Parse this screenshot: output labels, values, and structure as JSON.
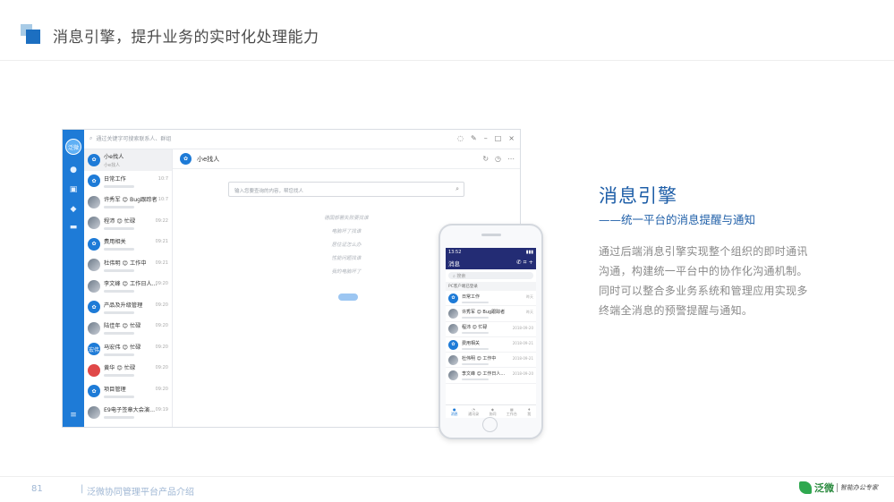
{
  "header": {
    "title": "消息引擎，提升业务的实时化处理能力"
  },
  "desktop": {
    "rail_avatar": "泛微",
    "search_placeholder": "通过关键字可搜索联系人、群组",
    "chats": [
      {
        "name": "小e找人",
        "sub": "小e找人",
        "time": ""
      },
      {
        "name": "日常工作",
        "time": "10:7"
      },
      {
        "name": "许秀军 😊 Bug跟踪者",
        "time": "10:7"
      },
      {
        "name": "程沛 😊 忙碌",
        "time": "09:22"
      },
      {
        "name": "费用相关",
        "time": "09:21"
      },
      {
        "name": "杜伟明 😊 工作中",
        "time": "09:21"
      },
      {
        "name": "李文峰 😊 工作日人...",
        "time": "09:20"
      },
      {
        "name": "产品及升级管理",
        "time": "09:20"
      },
      {
        "name": "陆佳年 😊 忙碌",
        "time": "09:20"
      },
      {
        "name": "马宏伟 😊 忙碌",
        "time": "09:20"
      },
      {
        "name": "黄华 😊 忙碌",
        "time": "09:20"
      },
      {
        "name": "项目管理",
        "time": "09:20"
      },
      {
        "name": "E9电子签章大会演...",
        "time": "09:19"
      }
    ],
    "chat_title": "小e找人",
    "chat_search_placeholder": "输入您要查询的内容，帮您找人",
    "suggestions": [
      "德国部署失败要找谁",
      "电脑坏了找谁",
      "居住证怎么办",
      "性能问题找谁",
      "我的电脑坏了"
    ]
  },
  "mobile": {
    "time": "13:52",
    "title": "消息",
    "search": "搜索",
    "pc_status": "PC客户端已登录",
    "chats": [
      {
        "name": "日常工作",
        "time": "昨天"
      },
      {
        "name": "许秀军 😊 Bug跟踪者",
        "time": "昨天"
      },
      {
        "name": "程沛 😊 忙碌",
        "time": "2018-09-20"
      },
      {
        "name": "费用相关",
        "time": "2018-09-21"
      },
      {
        "name": "杜伟明 😊 工作中",
        "time": "2018-09-21"
      },
      {
        "name": "李文峰 😊 工作日人...",
        "time": "2018-09-20"
      }
    ],
    "tabs": [
      "消息",
      "通讯录",
      "协同",
      "工作台",
      "我"
    ]
  },
  "right": {
    "title": "消息引擎",
    "subtitle": "——统一平台的消息提醒与通知",
    "body": "通过后端消息引擎实现整个组织的即时通讯沟通，构建统一平台中的协作化沟通机制。同时可以整合多业务系统和管理应用实现多终端全消息的预警提醒与通知。"
  },
  "footer": {
    "page": "81",
    "separator": "|",
    "text": "泛微协同管理平台产品介绍",
    "brand": "泛微",
    "slogan": "智能办公专家"
  },
  "colors": {
    "accent": "#1e7bd7",
    "title_blue": "#1f5fa8",
    "phone_header": "#232c74"
  }
}
